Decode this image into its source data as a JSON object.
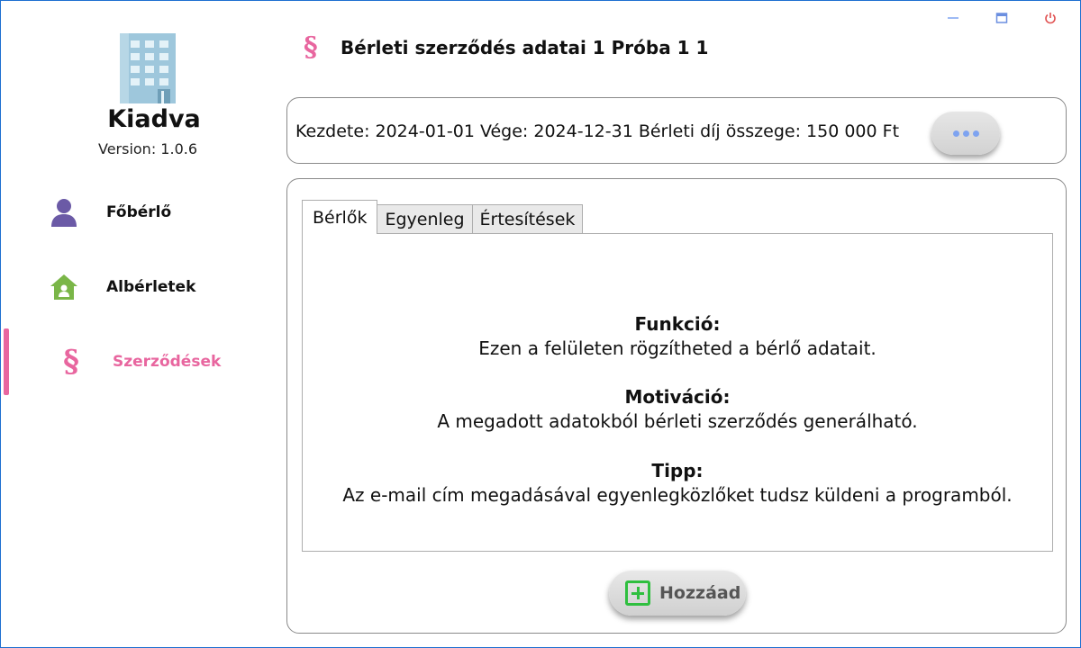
{
  "window": {
    "controls": [
      {
        "name": "minimize-icon",
        "color": "#7ea3f0"
      },
      {
        "name": "maximize-icon",
        "color": "#7ea3f0"
      },
      {
        "name": "power-icon",
        "color": "#e05050"
      }
    ]
  },
  "sidebar": {
    "app_name": "Kiadva",
    "version": "Version: 1.0.6",
    "logo_icon": "building-icon",
    "items": [
      {
        "label": "Főbérlő",
        "icon": "user-icon",
        "color": "#6b5aa6"
      },
      {
        "label": "Albérletek",
        "icon": "home-icon",
        "color": "#7ab648"
      },
      {
        "label": "Szerződések",
        "icon": "paragraph-icon",
        "color": "#e8669f",
        "active": true
      }
    ]
  },
  "header": {
    "icon_glyph": "§",
    "title": "Bérleti szerződés adatai 1 Próba 1 1"
  },
  "info": {
    "text": "Kezdete: 2024-01-01 Vége: 2024-12-31 Bérleti díj összege: 150 000 Ft",
    "more_icon": "ellipsis-icon"
  },
  "tabs": [
    {
      "label": "Bérlők",
      "active": true
    },
    {
      "label": "Egyenleg"
    },
    {
      "label": "Értesítések"
    }
  ],
  "content": {
    "sections": [
      {
        "heading": "Funkció:",
        "text": "Ezen a felületen rögzítheted a bérlő adatait."
      },
      {
        "heading": "Motiváció:",
        "text": "A megadott adatokból bérleti szerződés generálható."
      },
      {
        "heading": "Tipp:",
        "text": "Az e-mail cím megadásával egyenlegközlőket tudsz küldeni a programból."
      }
    ]
  },
  "actions": {
    "add_label": "Hozzáad",
    "add_icon": "plus-icon"
  },
  "colors": {
    "accent": "#e8669f",
    "window_border": "#1e6fd0",
    "add_green": "#2fbf3f"
  }
}
